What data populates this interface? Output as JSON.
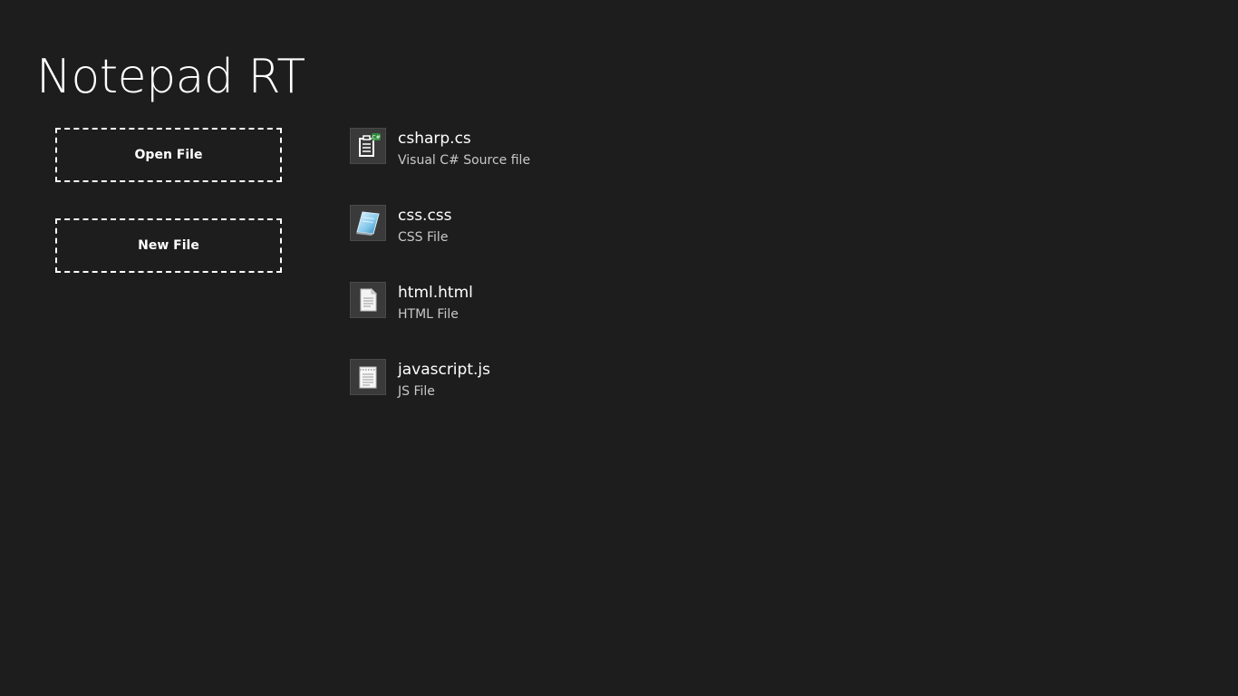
{
  "app": {
    "title": "Notepad RT"
  },
  "actions": {
    "open_label": "Open File",
    "new_label": "New File"
  },
  "files": [
    {
      "name": "csharp.cs",
      "type": "Visual C# Source file",
      "icon": "csharp-file-icon"
    },
    {
      "name": "css.css",
      "type": "CSS File",
      "icon": "css-file-icon"
    },
    {
      "name": "html.html",
      "type": "HTML File",
      "icon": "html-file-icon"
    },
    {
      "name": "javascript.js",
      "type": "JS File",
      "icon": "js-file-icon"
    }
  ],
  "colors": {
    "background": "#1d1d1d",
    "text": "#ffffff",
    "secondary_text": "#c8c8c8",
    "icon_tile": "#3a3a3a",
    "csharp_badge": "#2e8b3a"
  }
}
